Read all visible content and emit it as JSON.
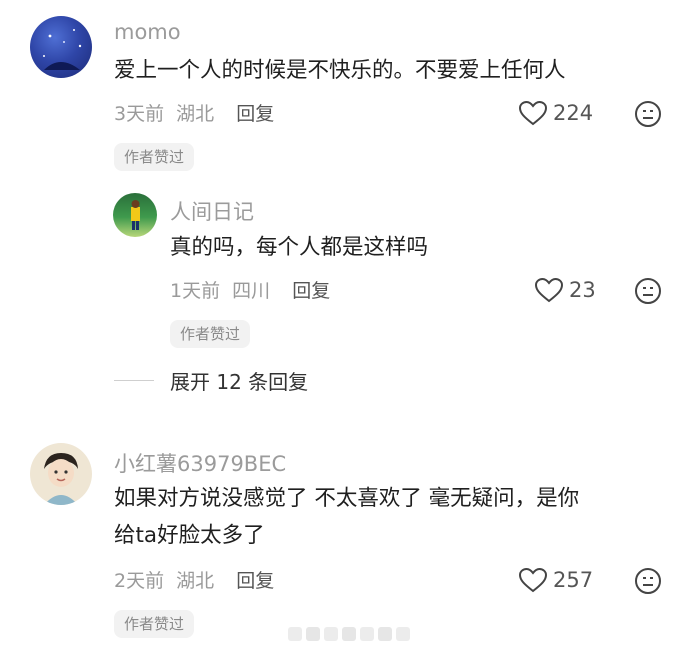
{
  "comments": [
    {
      "name": "momo",
      "text": [
        "爱上一个人的时候是不快乐的。不要爱上任何人"
      ],
      "time": "3天前",
      "location": "湖北",
      "reply_label": "回复",
      "likes": "224",
      "badge": "作者赞过",
      "replies": [
        {
          "name": "人间日记",
          "text": "真的吗，每个人都是这样吗",
          "time": "1天前",
          "location": "四川",
          "reply_label": "回复",
          "likes": "23",
          "badge": "作者赞过"
        }
      ],
      "expand_label": "展开 12 条回复"
    },
    {
      "name": "小红薯63979BEC",
      "text": [
        "如果对方说没感觉了 不太喜欢了 毫无疑问，是你",
        "给ta好脸太多了"
      ],
      "time": "2天前",
      "location": "湖北",
      "reply_label": "回复",
      "likes": "257",
      "badge": "作者赞过"
    }
  ],
  "icons": {
    "like": "heart-outline-icon",
    "dislike": "meh-face-icon"
  },
  "colors": {
    "name": "#9b9b9b",
    "text": "#1f1f1f",
    "badge_bg": "#f2f2f2"
  }
}
